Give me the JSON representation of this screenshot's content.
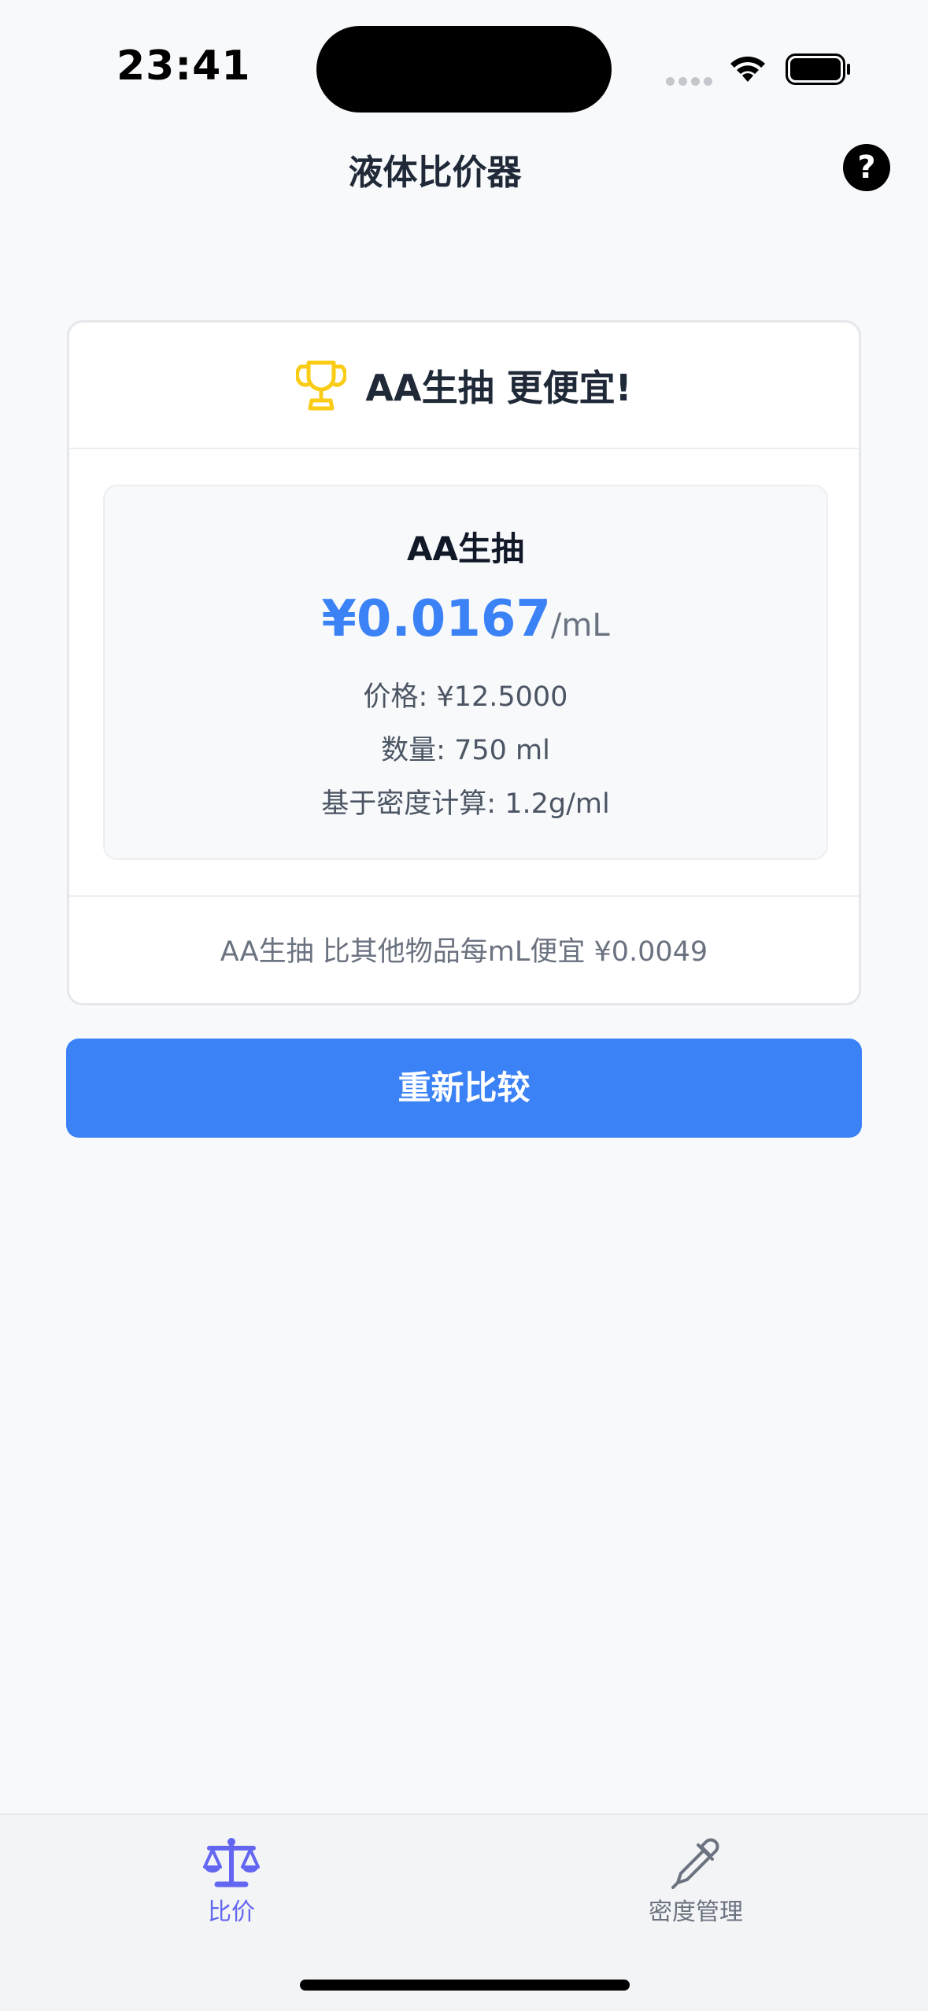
{
  "status_bar": {
    "time": "23:41"
  },
  "header": {
    "title": "液体比价器",
    "help_label": "?"
  },
  "result": {
    "winner_text": "AA生抽 更便宜!",
    "item_name": "AA生抽",
    "unit_price": "¥0.0167",
    "unit_label": "/mL",
    "price_line": "价格: ¥12.5000",
    "quantity_line": "数量: 750 ml",
    "density_line": "基于密度计算: 1.2g/ml",
    "savings_text": "AA生抽 比其他物品每mL便宜 ¥0.0049"
  },
  "actions": {
    "recompare_label": "重新比较"
  },
  "tab_bar": {
    "items": [
      {
        "label": "比价",
        "icon": "scale-icon",
        "active": true
      },
      {
        "label": "密度管理",
        "icon": "dropper-icon",
        "active": false
      }
    ]
  },
  "colors": {
    "accent": "#3b82f6",
    "active_tab": "#6366f1",
    "trophy": "#facc15",
    "background": "#f8f9fb"
  }
}
